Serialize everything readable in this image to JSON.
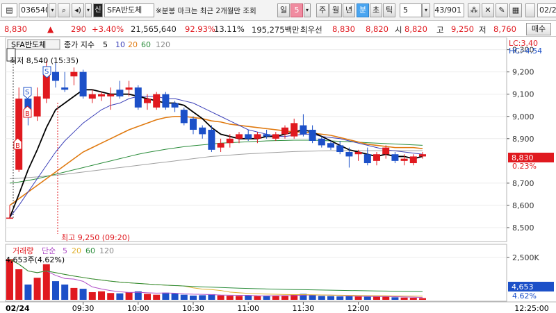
{
  "toolbar": {
    "code": "036540",
    "search_icon": "search-icon",
    "stock_name": "SFA반도체",
    "notice": "※분봉 마크는 최근 2개월만 조회",
    "period_tabs": [
      "일",
      "주",
      "월",
      "년",
      "분",
      "초",
      "틱"
    ],
    "day_count": "5",
    "min_count": "5",
    "page_counter": "43/901",
    "date_field": "02/2"
  },
  "quote": {
    "price": "8,830",
    "arrow": "▲",
    "change": "290",
    "change_pct": "+3.40%",
    "volume": "21,565,640",
    "vol_ratio": "92.93%",
    "turnover": "13.11%",
    "amount": "195,275백만",
    "best_label": "최우선",
    "best_ask": "8,830",
    "best_bid": "8,820",
    "open_label": "시",
    "open": "8,820",
    "high_label": "고",
    "high": "9,250",
    "low_label": "저",
    "low": "8,760",
    "buy_button": "매수"
  },
  "legend": {
    "name": "SFA반도체",
    "ma_label": "종가 지수",
    "periods": [
      "5",
      "10",
      "20",
      "60",
      "120"
    ],
    "period_colors": [
      "#000000",
      "#3a3fb8",
      "#e07a10",
      "#2a8c3a",
      "#888888"
    ]
  },
  "markers": {
    "low_note": "최저 8,540 (15:35)",
    "high_note": "최고 9,250 (09:20)",
    "lc": "LC:3.40",
    "hc": "HC:-4.54",
    "current_price": "8,830",
    "current_pct": "0.23%",
    "volume_value": "4,653",
    "volume_pct": "4.62%",
    "volume_note": "4,653주(4.62%)",
    "signal_letters": [
      "S",
      "B",
      "S",
      "B"
    ]
  },
  "volume_legend": {
    "title": "거래량",
    "type": "단순",
    "periods": [
      "5",
      "20",
      "60",
      "120"
    ]
  },
  "price_axis": [
    "9,300",
    "9,200",
    "9,100",
    "9,000",
    "8,900",
    "8,700",
    "8,600",
    "8,500"
  ],
  "volume_axis": [
    "2,500K"
  ],
  "time_axis": [
    "02/24",
    "09:30",
    "10:00",
    "10:30",
    "11:00",
    "11:30",
    "12:00",
    "12:25:00"
  ],
  "colors": {
    "up": "#e0191f",
    "down": "#1c50c8",
    "highlight": "#e0191f",
    "volume_box": "#1c50c8"
  },
  "chart_data": {
    "type": "candlestick",
    "interval": "5분",
    "ylim": [
      8450,
      9330
    ],
    "candles": [
      {
        "o": 8540,
        "h": 8600,
        "l": 8540,
        "c": 8545
      },
      {
        "o": 8760,
        "h": 9130,
        "l": 8750,
        "c": 9080
      },
      {
        "o": 9080,
        "h": 9130,
        "l": 8960,
        "c": 9000
      },
      {
        "o": 9000,
        "h": 9130,
        "l": 8980,
        "c": 9090
      },
      {
        "o": 9080,
        "h": 9250,
        "l": 9060,
        "c": 9200
      },
      {
        "o": 9200,
        "h": 9240,
        "l": 9130,
        "c": 9160
      },
      {
        "o": 9130,
        "h": 9200,
        "l": 9110,
        "c": 9120
      },
      {
        "o": 9180,
        "h": 9220,
        "l": 9140,
        "c": 9200
      },
      {
        "o": 9200,
        "h": 9210,
        "l": 9080,
        "c": 9090
      },
      {
        "o": 9080,
        "h": 9120,
        "l": 9060,
        "c": 9100
      },
      {
        "o": 9090,
        "h": 9110,
        "l": 9070,
        "c": 9100
      },
      {
        "o": 9090,
        "h": 9130,
        "l": 9030,
        "c": 9100
      },
      {
        "o": 9120,
        "h": 9160,
        "l": 9080,
        "c": 9090
      },
      {
        "o": 9120,
        "h": 9160,
        "l": 9090,
        "c": 9130
      },
      {
        "o": 9130,
        "h": 9140,
        "l": 9030,
        "c": 9040
      },
      {
        "o": 9060,
        "h": 9100,
        "l": 9030,
        "c": 9080
      },
      {
        "o": 9040,
        "h": 9110,
        "l": 9030,
        "c": 9100
      },
      {
        "o": 9100,
        "h": 9110,
        "l": 9030,
        "c": 9040
      },
      {
        "o": 9060,
        "h": 9070,
        "l": 9020,
        "c": 9040
      },
      {
        "o": 9030,
        "h": 9040,
        "l": 8960,
        "c": 8970
      },
      {
        "o": 8990,
        "h": 9000,
        "l": 8920,
        "c": 8940
      },
      {
        "o": 8950,
        "h": 8960,
        "l": 8900,
        "c": 8920
      },
      {
        "o": 8940,
        "h": 8960,
        "l": 8840,
        "c": 8850
      },
      {
        "o": 8860,
        "h": 8900,
        "l": 8840,
        "c": 8880
      },
      {
        "o": 8880,
        "h": 8920,
        "l": 8860,
        "c": 8900
      },
      {
        "o": 8900,
        "h": 8930,
        "l": 8880,
        "c": 8920
      },
      {
        "o": 8920,
        "h": 8940,
        "l": 8890,
        "c": 8900
      },
      {
        "o": 8900,
        "h": 8930,
        "l": 8880,
        "c": 8920
      },
      {
        "o": 8920,
        "h": 8940,
        "l": 8900,
        "c": 8910
      },
      {
        "o": 8900,
        "h": 8930,
        "l": 8890,
        "c": 8920
      },
      {
        "o": 8920,
        "h": 8960,
        "l": 8900,
        "c": 8950
      },
      {
        "o": 8910,
        "h": 8990,
        "l": 8900,
        "c": 8970
      },
      {
        "o": 8960,
        "h": 9010,
        "l": 8910,
        "c": 8920
      },
      {
        "o": 8940,
        "h": 8960,
        "l": 8880,
        "c": 8890
      },
      {
        "o": 8900,
        "h": 8910,
        "l": 8860,
        "c": 8870
      },
      {
        "o": 8880,
        "h": 8890,
        "l": 8850,
        "c": 8860
      },
      {
        "o": 8870,
        "h": 8890,
        "l": 8830,
        "c": 8840
      },
      {
        "o": 8840,
        "h": 8860,
        "l": 8770,
        "c": 8820
      },
      {
        "o": 8830,
        "h": 8850,
        "l": 8800,
        "c": 8840
      },
      {
        "o": 8830,
        "h": 8860,
        "l": 8780,
        "c": 8790
      },
      {
        "o": 8800,
        "h": 8840,
        "l": 8780,
        "c": 8830
      },
      {
        "o": 8830,
        "h": 8870,
        "l": 8810,
        "c": 8860
      },
      {
        "o": 8830,
        "h": 8840,
        "l": 8790,
        "c": 8800
      },
      {
        "o": 8800,
        "h": 8830,
        "l": 8780,
        "c": 8810
      },
      {
        "o": 8790,
        "h": 8830,
        "l": 8780,
        "c": 8820
      },
      {
        "o": 8820,
        "h": 8840,
        "l": 8810,
        "c": 8830
      }
    ],
    "ma5": [
      8545,
      8650,
      8760,
      8850,
      8950,
      9030,
      9060,
      9090,
      9120,
      9120,
      9110,
      9100,
      9100,
      9100,
      9090,
      9080,
      9070,
      9060,
      9060,
      9050,
      9020,
      8990,
      8950,
      8920,
      8910,
      8900,
      8900,
      8900,
      8910,
      8910,
      8920,
      8930,
      8940,
      8930,
      8910,
      8890,
      8870,
      8850,
      8840,
      8830,
      8820,
      8830,
      8820,
      8820,
      8810,
      8820
    ],
    "ma10": [
      8545,
      8600,
      8660,
      8720,
      8780,
      8840,
      8890,
      8930,
      8970,
      9000,
      9030,
      9050,
      9060,
      9080,
      9090,
      9090,
      9090,
      9080,
      9080,
      9070,
      9060,
      9040,
      9020,
      9000,
      8980,
      8960,
      8940,
      8930,
      8920,
      8910,
      8910,
      8915,
      8920,
      8920,
      8910,
      8905,
      8900,
      8890,
      8880,
      8870,
      8860,
      8850,
      8845,
      8840,
      8835,
      8830
    ],
    "ma20": [
      8600,
      8630,
      8660,
      8690,
      8720,
      8750,
      8780,
      8810,
      8840,
      8860,
      8880,
      8900,
      8920,
      8940,
      8955,
      8970,
      8985,
      8995,
      9000,
      9000,
      8995,
      8990,
      8980,
      8975,
      8965,
      8960,
      8955,
      8950,
      8945,
      8940,
      8935,
      8930,
      8930,
      8925,
      8920,
      8915,
      8905,
      8895,
      8885,
      8875,
      8870,
      8865,
      8860,
      8860,
      8860,
      8855
    ],
    "ma60": [
      8700,
      8705,
      8712,
      8720,
      8730,
      8740,
      8750,
      8760,
      8770,
      8780,
      8790,
      8800,
      8810,
      8820,
      8830,
      8838,
      8845,
      8852,
      8858,
      8864,
      8868,
      8872,
      8876,
      8880,
      8882,
      8884,
      8886,
      8888,
      8890,
      8891,
      8892,
      8893,
      8893,
      8893,
      8892,
      8890,
      8888,
      8886,
      8884,
      8882,
      8880,
      8878,
      8876,
      8874,
      8872,
      8870
    ],
    "ma120": [
      8720,
      8722,
      8725,
      8728,
      8732,
      8736,
      8740,
      8745,
      8750,
      8755,
      8760,
      8765,
      8770,
      8775,
      8780,
      8785,
      8790,
      8795,
      8800,
      8805,
      8810,
      8815,
      8820,
      8823,
      8826,
      8829,
      8832,
      8834,
      8836,
      8838,
      8840,
      8842,
      8843,
      8844,
      8845,
      8846,
      8846,
      8846,
      8846,
      8846,
      8846,
      8846,
      8846,
      8846,
      8846,
      8846
    ],
    "volume": [
      2400,
      1800,
      900,
      1300,
      2100,
      1100,
      900,
      700,
      650,
      450,
      500,
      400,
      380,
      450,
      500,
      350,
      300,
      420,
      380,
      300,
      250,
      270,
      330,
      260,
      240,
      230,
      260,
      220,
      230,
      250,
      260,
      300,
      350,
      270,
      230,
      220,
      200,
      210,
      200,
      180,
      190,
      200,
      150,
      130,
      120,
      100
    ],
    "vol_ylim": [
      0,
      2700
    ]
  }
}
